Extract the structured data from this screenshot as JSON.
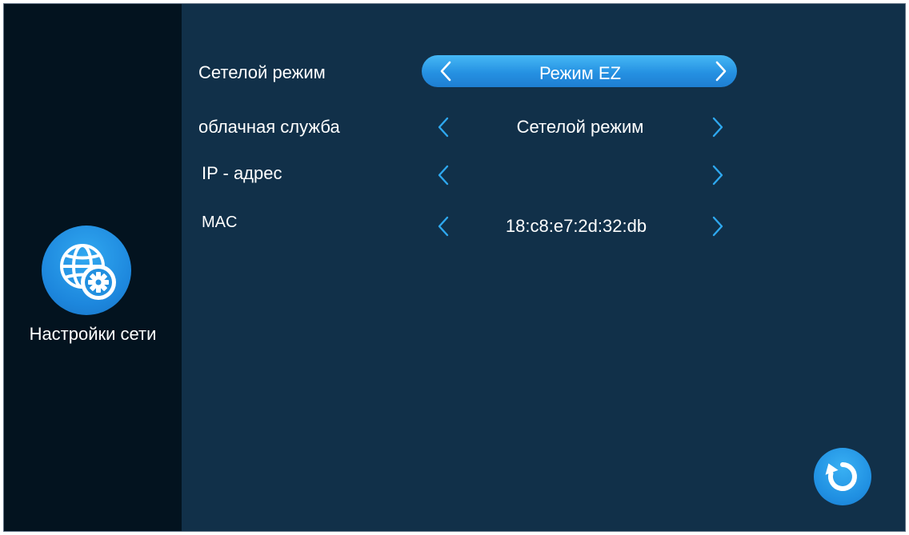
{
  "sidebar": {
    "icon": "globe-gear-icon",
    "label": "Настройки сети"
  },
  "rows": [
    {
      "label": "Сетелой режим",
      "value": "Режим EZ",
      "selected": true
    },
    {
      "label": "облачная служба",
      "value": "Сетелой режим",
      "selected": false
    },
    {
      "label": "IP - адрес",
      "value": "",
      "selected": false
    },
    {
      "label": "MAC",
      "value": "18:c8:e7:2d:32:db",
      "selected": false
    }
  ],
  "actions": {
    "refresh_icon": "refresh-icon"
  },
  "colors": {
    "background": "#113049",
    "sidebar": "#03131f",
    "accent": "#2ea8ef",
    "selected_bar": "#2591e2",
    "text": "#ffffff"
  }
}
